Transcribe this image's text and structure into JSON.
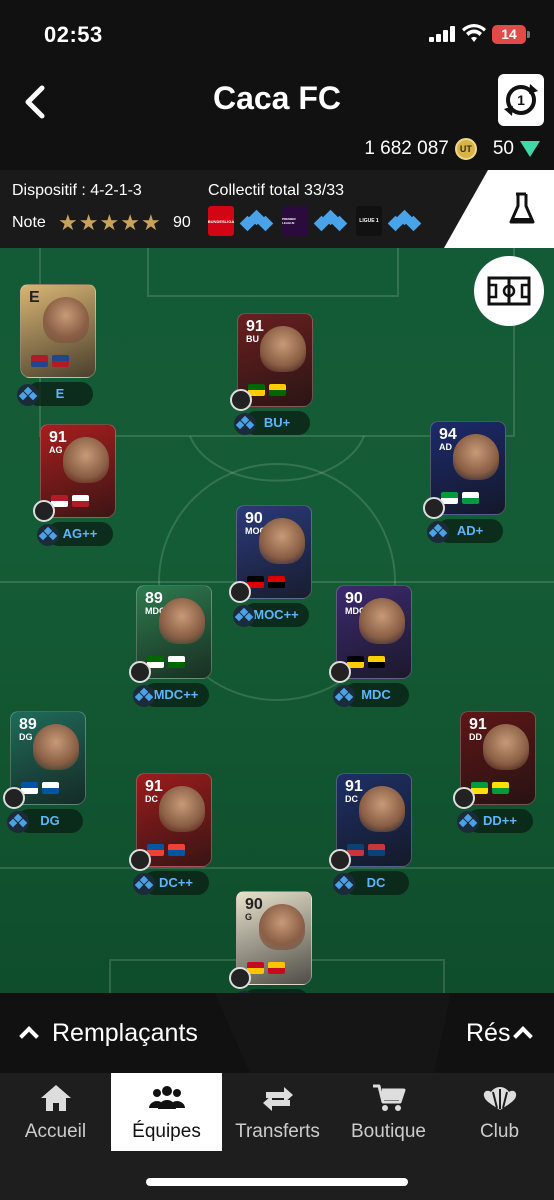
{
  "status_bar": {
    "time": "02:53",
    "battery": "14"
  },
  "header": {
    "title": "Caca FC",
    "coins": "1 682 087",
    "coin_symbol": "UT",
    "points": "50"
  },
  "info": {
    "dispositif": "Dispositif : 4-2-1-3",
    "collectif": "Collectif total 33/33",
    "note_label": "Note",
    "stars": 5,
    "note_value": "90",
    "leagues": [
      "BUNDESLIGA",
      "PREMIER LEAGUE",
      "LIGUE 1"
    ]
  },
  "players": [
    {
      "rating": "E",
      "position": "",
      "label": "E",
      "color": "#d8b574"
    },
    {
      "rating": "91",
      "position": "BU",
      "label": "BU+",
      "color": "#6a1f1f"
    },
    {
      "rating": "91",
      "position": "AG",
      "label": "AG++",
      "color": "#a81e1e"
    },
    {
      "rating": "94",
      "position": "AD",
      "label": "AD+",
      "color": "#1c2a6b"
    },
    {
      "rating": "90",
      "position": "MOC",
      "label": "MOC++",
      "color": "#2a3a7a"
    },
    {
      "rating": "89",
      "position": "MDC",
      "label": "MDC++",
      "color": "#2d7a4e"
    },
    {
      "rating": "90",
      "position": "MDC",
      "label": "MDC",
      "color": "#3b2a6e"
    },
    {
      "rating": "89",
      "position": "DG",
      "label": "DG",
      "color": "#1f6b5a"
    },
    {
      "rating": "91",
      "position": "DC",
      "label": "DC++",
      "color": "#9b1c1c"
    },
    {
      "rating": "91",
      "position": "DC",
      "label": "DC",
      "color": "#1e2f66"
    },
    {
      "rating": "91",
      "position": "DD",
      "label": "DD++",
      "color": "#5e1616"
    },
    {
      "rating": "90",
      "position": "G",
      "label": "G",
      "color": "#e8e2cc"
    }
  ],
  "bottom": {
    "bench": "Remplaçants",
    "reserves": "Rés"
  },
  "nav": [
    {
      "label": "Accueil",
      "icon": "home-icon"
    },
    {
      "label": "Équipes",
      "icon": "team-icon"
    },
    {
      "label": "Transferts",
      "icon": "transfer-icon"
    },
    {
      "label": "Boutique",
      "icon": "cart-icon"
    },
    {
      "label": "Club",
      "icon": "club-icon"
    }
  ],
  "colors": {
    "accent_blue": "#4aa3e8",
    "pitch": "#135a36",
    "gold": "#c9a35a"
  }
}
